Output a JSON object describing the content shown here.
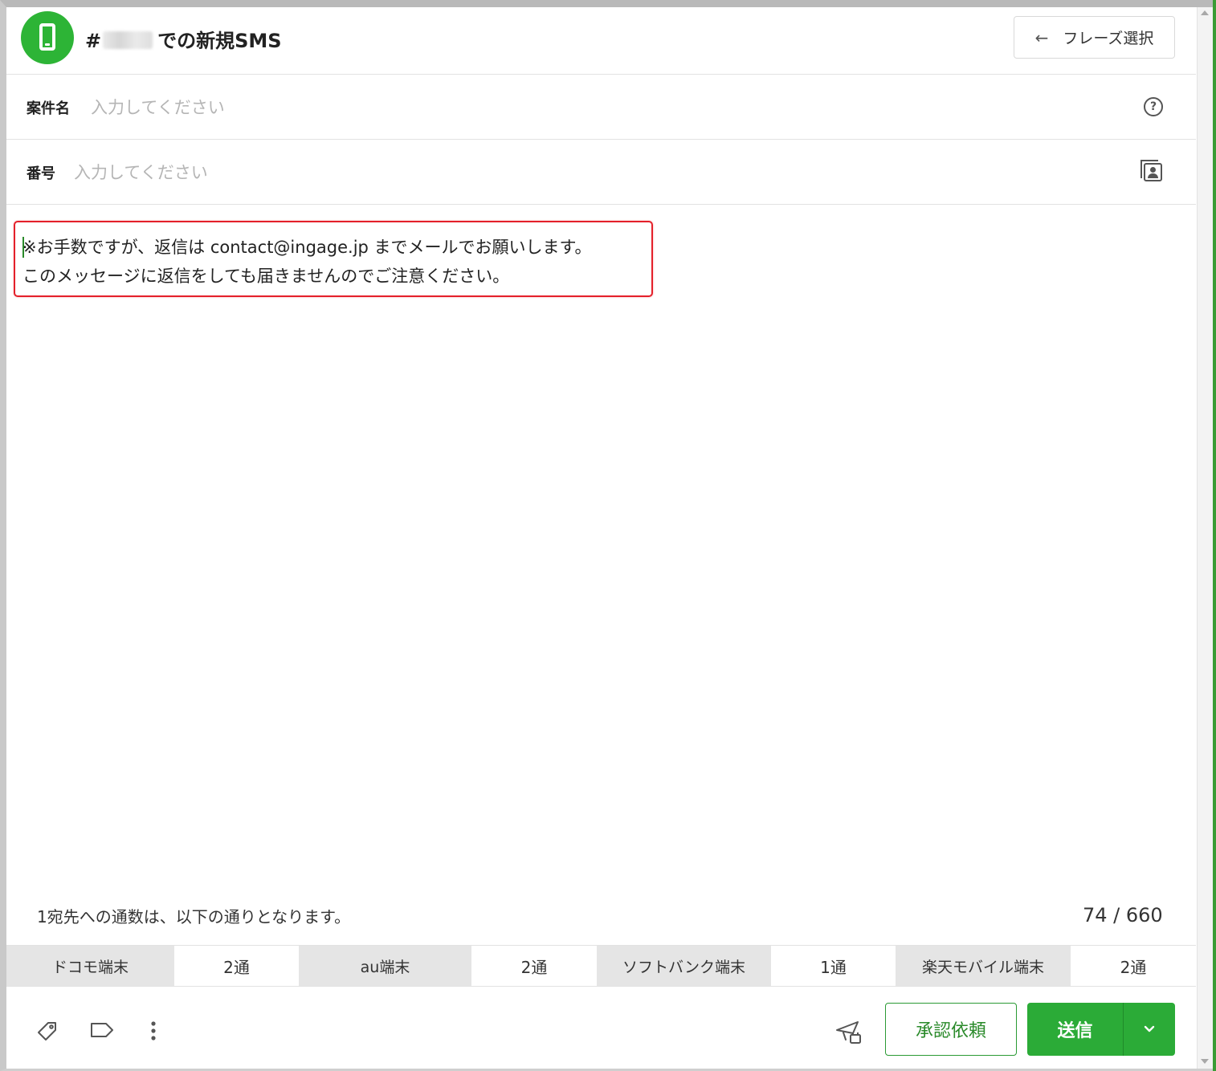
{
  "header": {
    "title_prefix": "#",
    "title_suffix": "での新規SMS",
    "phrase_button": "フレーズ選択",
    "back_arrow": "←"
  },
  "fields": {
    "case_name": {
      "label": "案件名",
      "placeholder": "入力してください",
      "value": ""
    },
    "number": {
      "label": "番号",
      "placeholder": "入力してください",
      "value": ""
    }
  },
  "message": {
    "lines": [
      "※お手数ですが、返信は contact@ingage.jp までメールでお願いします。",
      "このメッセージに返信をしても届きませんのでご注意ください。"
    ]
  },
  "counts": {
    "note": "1宛先への通数は、以下の通りとなります。",
    "characters": "74 / 660",
    "carriers": [
      {
        "name": "ドコモ端末",
        "count": "2通"
      },
      {
        "name": "au端末",
        "count": "2通"
      },
      {
        "name": "ソフトバンク端末",
        "count": "1通"
      },
      {
        "name": "楽天モバイル端末",
        "count": "2通"
      }
    ]
  },
  "footer": {
    "approve_button": "承認依頼",
    "send_button": "送信"
  },
  "icons": {
    "app": "phone-icon",
    "help": "question-circle-icon",
    "contacts": "contact-book-icon",
    "tag": "tag-icon",
    "label": "label-icon",
    "more": "more-vertical-icon",
    "schedule": "scheduled-send-icon",
    "dropdown": "chevron-down-icon"
  },
  "colors": {
    "accent": "#2bab37",
    "highlight_border": "#e4202a",
    "carrier_header_bg": "#e5e5e5"
  }
}
